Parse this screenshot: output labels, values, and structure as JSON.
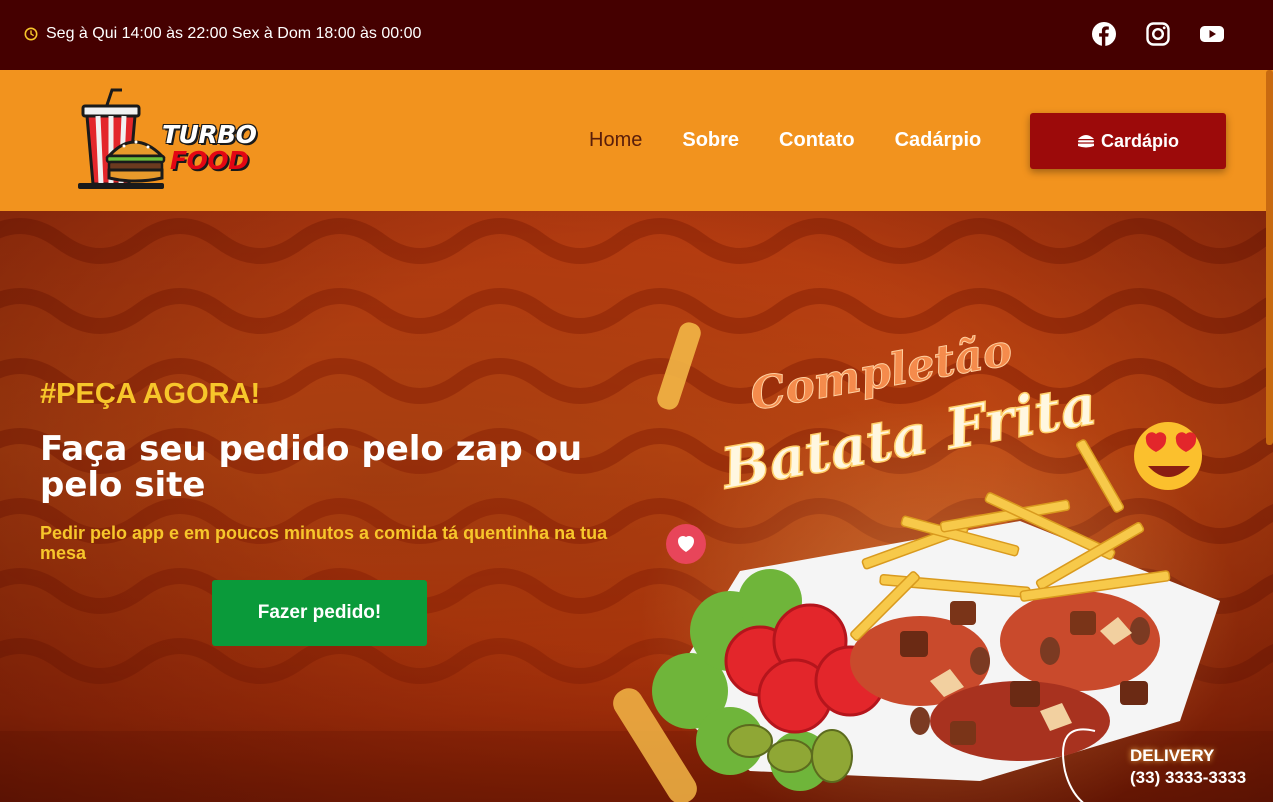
{
  "topbar": {
    "hours": "Seg à Qui 14:00 às 22:00 Sex à Dom 18:00 às 00:00",
    "social": [
      {
        "icon": "facebook-icon"
      },
      {
        "icon": "instagram-icon"
      },
      {
        "icon": "youtube-icon"
      }
    ]
  },
  "header": {
    "logo": {
      "line1": "TURBO",
      "line2": "FOOD"
    },
    "nav": [
      {
        "label": "Home",
        "active": true
      },
      {
        "label": "Sobre",
        "active": false
      },
      {
        "label": "Contato",
        "active": false
      },
      {
        "label": "Cadárpio",
        "active": false
      }
    ],
    "menu_button": "Cardápio"
  },
  "hero": {
    "kicker": "#PEÇA AGORA!",
    "headline": "Faça seu pedido pelo zap ou pelo site",
    "subtitle": "Pedir pelo app e em poucos minutos a comida tá quentinha na tua mesa",
    "cta": "Fazer pedido!",
    "promo": {
      "line1": "Completão",
      "line2": "Batata Frita",
      "delivery_label": "DELIVERY",
      "phone": "(33) 3333-3333"
    }
  },
  "colors": {
    "topbar": "#450000",
    "header": "#f2931e",
    "accent_red": "#9c0a0a",
    "cta_green": "#0a9a3a",
    "kicker_yellow": "#f7c62b"
  }
}
